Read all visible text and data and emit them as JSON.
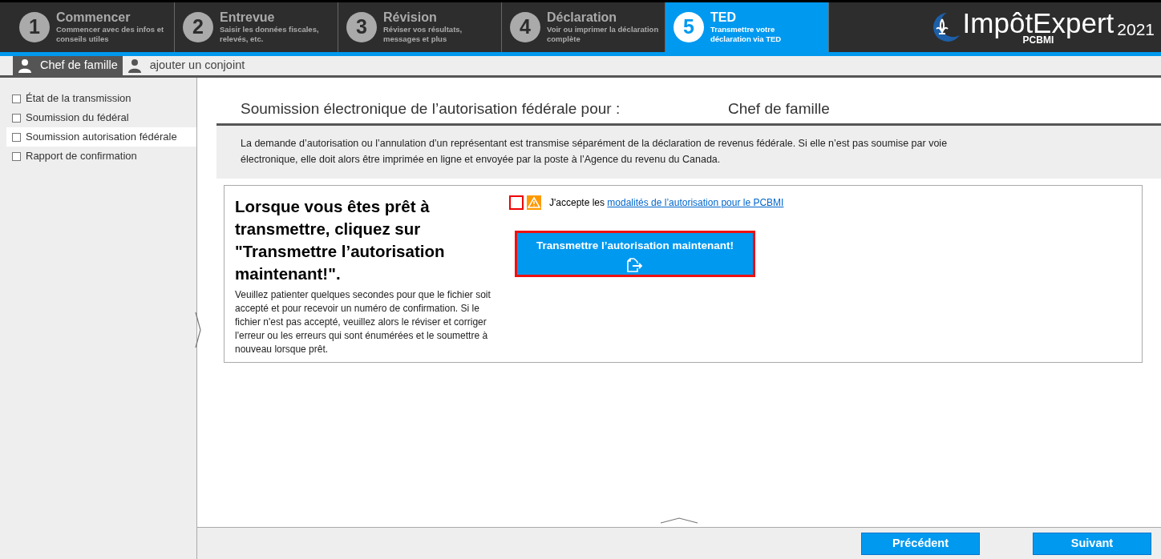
{
  "steps": [
    {
      "number": "1",
      "title": "Commencer",
      "subtitle": "Commencer avec des infos et conseils utiles",
      "selected": false
    },
    {
      "number": "2",
      "title": "Entrevue",
      "subtitle": "Saisir les données fiscales, relevés, etc.",
      "selected": false
    },
    {
      "number": "3",
      "title": "Révision",
      "subtitle": "Réviser vos résultats, messages et plus",
      "selected": false
    },
    {
      "number": "4",
      "title": "Déclaration",
      "subtitle": "Voir ou imprimer la déclaration complète",
      "selected": false
    },
    {
      "number": "5",
      "title": "TED",
      "subtitle": "Transmettre votre déclaration via TED",
      "selected": true
    }
  ],
  "logo": {
    "name": "ImpôtExpert",
    "year": "2021",
    "edition": "PCBMI"
  },
  "person_tabs": [
    {
      "label": "Chef de famille",
      "selected": true
    },
    {
      "label": "ajouter un conjoint",
      "selected": false
    }
  ],
  "sidebar": {
    "items": [
      {
        "label": "État de la transmission",
        "checked": false,
        "selected": false
      },
      {
        "label": "Soumission du fédéral",
        "checked": false,
        "selected": false
      },
      {
        "label": "Soumission autorisation fédérale",
        "checked": false,
        "selected": true
      },
      {
        "label": "Rapport de confirmation",
        "checked": false,
        "selected": false
      }
    ]
  },
  "main": {
    "heading": "Soumission électronique de l’autorisation fédérale pour :",
    "person": "Chef de famille",
    "notice": "La demande d’autorisation ou l’annulation d’un représentant est transmise séparément de la déclaration de revenus fédérale. Si elle n’est pas soumise par voie électronique, elle doit alors être imprimée en ligne et envoyée par la poste à l’Agence du revenu du Canada.",
    "instruction_title": "Lorsque vous êtes prêt à transmettre, cliquez sur \"Transmettre l’autorisation maintenant!\".",
    "instruction_text": "Veuillez patienter quelques secondes pour que le fichier soit accepté et pour recevoir un numéro de confirmation. Si le fichier n'est pas accepté, veuillez alors le réviser et corriger l'erreur ou les erreurs qui sont énumérées et le soumettre à nouveau lorsque prêt.",
    "accept": {
      "checked": false,
      "label": "J'accepte les",
      "link": "modalités de l’autorisation pour le PCBMI"
    },
    "transmit_button": "Transmettre l’autorisation maintenant!"
  },
  "footer": {
    "buttons": [
      "Précédent",
      "Suivant"
    ]
  }
}
